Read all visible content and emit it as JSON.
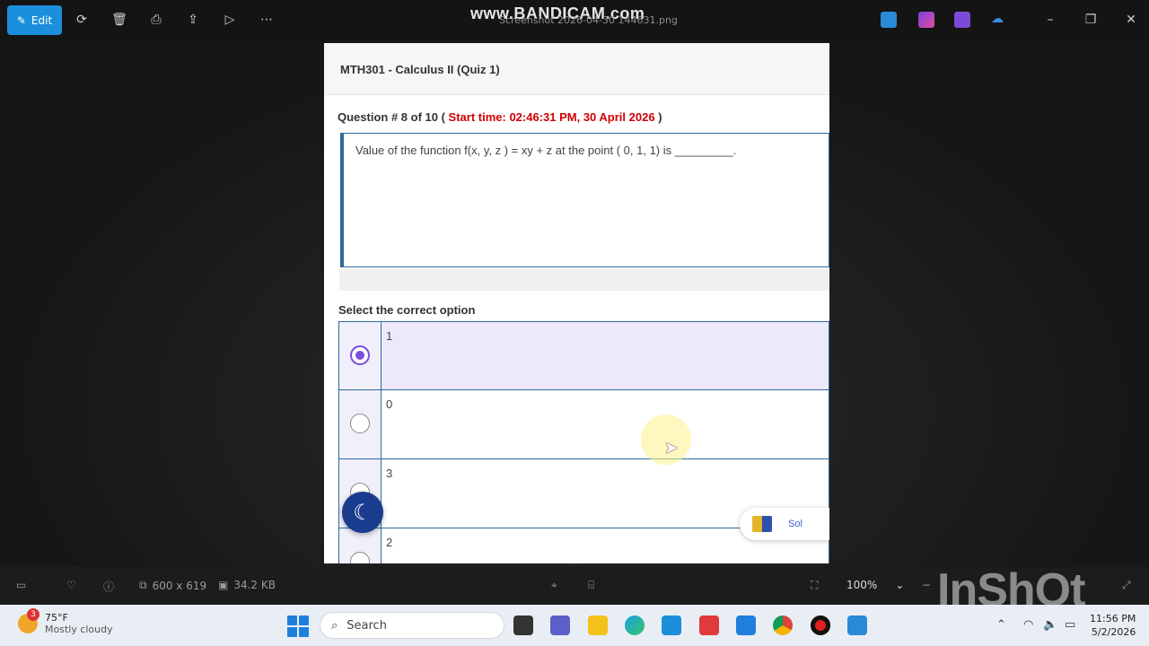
{
  "toolbar": {
    "edit_label": "Edit",
    "watermark": "www.BANDICAM.com",
    "file_title": "Screenshot 2026-04-30 144631.png"
  },
  "quiz": {
    "course_title": "MTH301 - Calculus II (Quiz 1)",
    "question_prefix": "Question # 8 of 10 (",
    "start_time": "Start time: 02:46:31 PM, 30 April 2026",
    "question_suffix": ")",
    "question_text": "Value of the function  f(x, y, z ) = xy + z at the point ( 0, 1, 1) is _________.",
    "select_label": "Select the correct option",
    "options": [
      {
        "label": "1",
        "selected": true
      },
      {
        "label": "0",
        "selected": false
      },
      {
        "label": "3",
        "selected": false
      },
      {
        "label": "2",
        "selected": false
      }
    ],
    "side_pill_text": "Sol"
  },
  "infobar": {
    "dimensions": "600 x 619",
    "file_size": "34.2 KB",
    "zoom": "100%",
    "inshot_watermark": "InShOt"
  },
  "taskbar": {
    "weather_badge": "3",
    "temperature": "75°F",
    "condition": "Mostly cloudy",
    "search_label": "Search",
    "time": "11:56 PM",
    "date": "5/2/2026"
  }
}
